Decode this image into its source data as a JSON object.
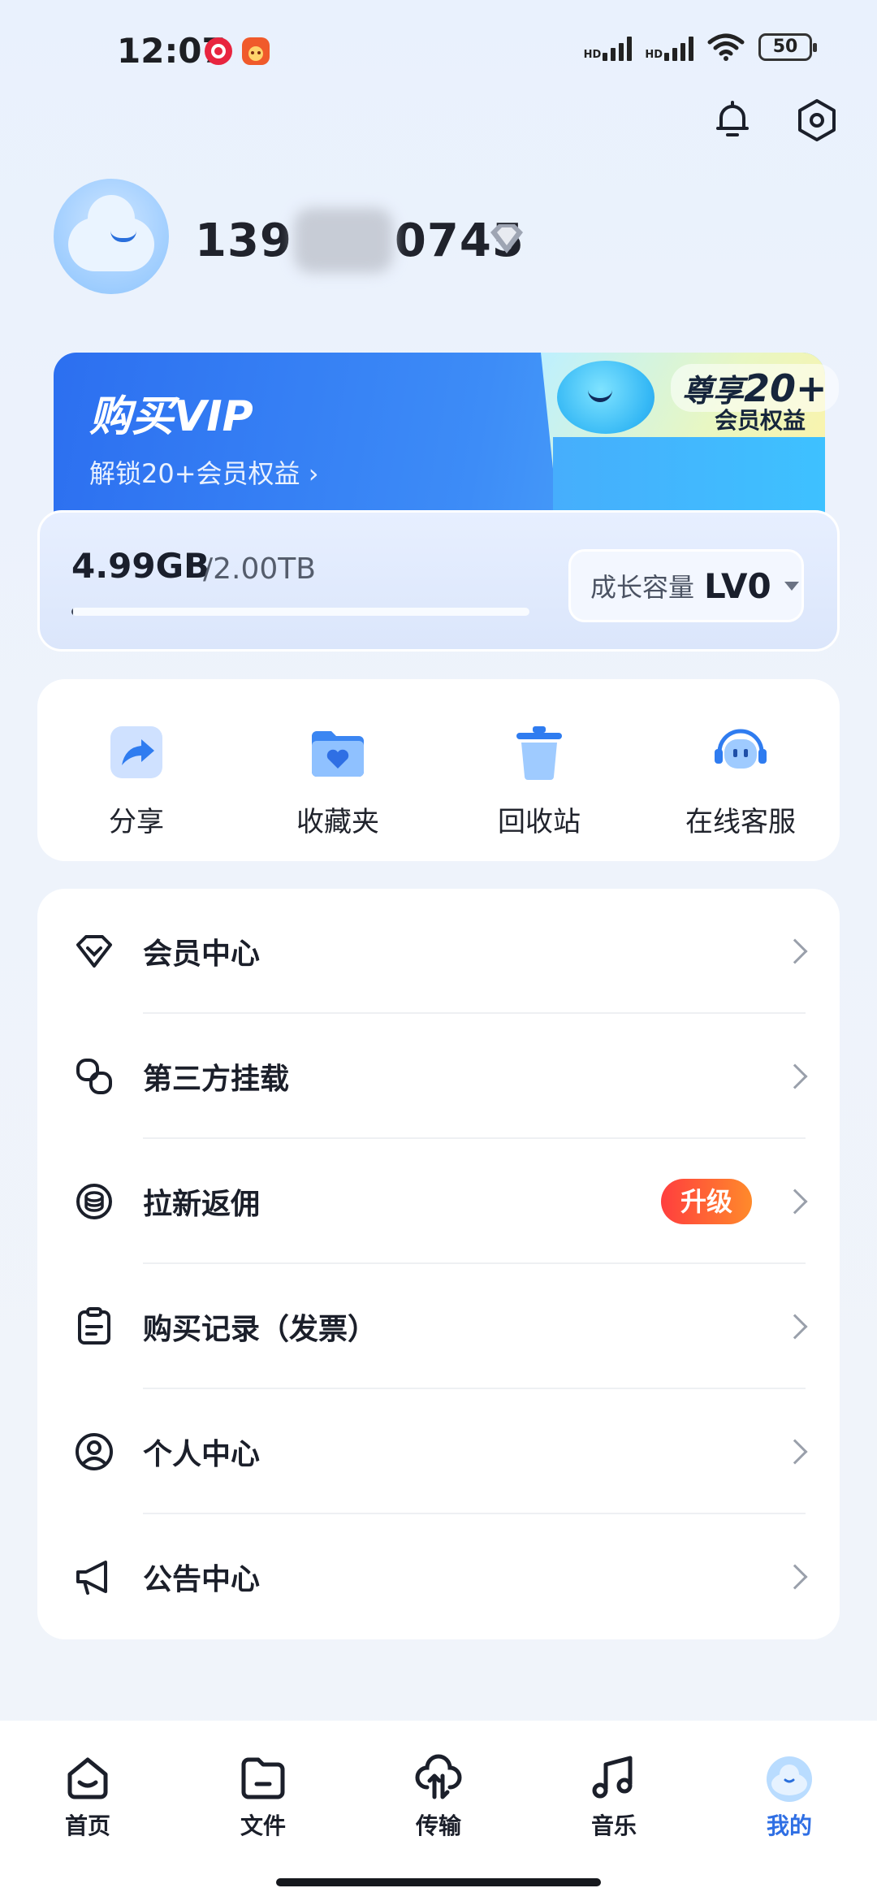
{
  "status_bar": {
    "time": "12:07",
    "network_1": "HD",
    "network_2": "HD",
    "battery": "50"
  },
  "profile": {
    "phone_prefix": "139",
    "phone_suffix": "0745"
  },
  "vip_banner": {
    "title": "购买VIP",
    "subtitle": "解锁20+会员权益 ›",
    "badge_prefix": "尊享",
    "badge_number": "20+",
    "badge_sub": "会员权益"
  },
  "storage": {
    "used": "4.99GB",
    "total": "/2.00TB",
    "used_fraction": 0.0024,
    "level_label": "成长容量",
    "level_value": "LV0"
  },
  "quick_actions": [
    {
      "label": "分享",
      "icon": "share-icon"
    },
    {
      "label": "收藏夹",
      "icon": "favorites-folder-icon"
    },
    {
      "label": "回收站",
      "icon": "trash-icon"
    },
    {
      "label": "在线客服",
      "icon": "customer-service-icon"
    }
  ],
  "menu": [
    {
      "label": "会员中心",
      "icon": "diamond-icon"
    },
    {
      "label": "第三方挂载",
      "icon": "link-icon"
    },
    {
      "label": "拉新返佣",
      "icon": "coin-icon",
      "badge": "升级"
    },
    {
      "label": "购买记录（发票）",
      "icon": "clipboard-icon"
    },
    {
      "label": "个人中心",
      "icon": "user-circle-icon"
    },
    {
      "label": "公告中心",
      "icon": "megaphone-icon"
    }
  ],
  "tabs": [
    {
      "label": "首页",
      "icon": "home-icon"
    },
    {
      "label": "文件",
      "icon": "folder-icon"
    },
    {
      "label": "传输",
      "icon": "transfer-cloud-icon"
    },
    {
      "label": "音乐",
      "icon": "music-icon"
    },
    {
      "label": "我的",
      "icon": "avatar-cloud-icon",
      "active": true
    }
  ],
  "colors": {
    "accent": "#2f6fe4",
    "upgrade_start": "#ff3e3e",
    "upgrade_end": "#ff8a2b"
  }
}
